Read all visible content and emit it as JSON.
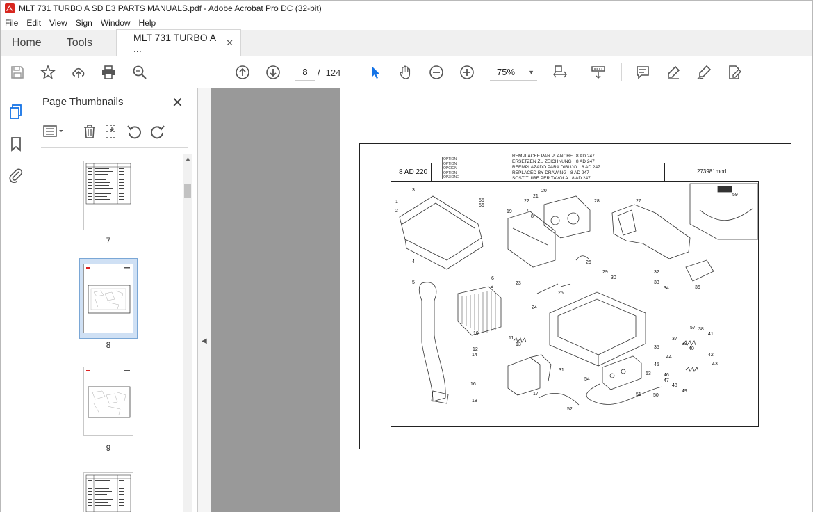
{
  "window": {
    "title": "MLT 731 TURBO A SD E3 PARTS MANUALS.pdf - Adobe Acrobat Pro DC (32-bit)",
    "controls": {
      "minimize": "—",
      "maximize": "☐",
      "close": "✕"
    }
  },
  "menu": [
    "File",
    "Edit",
    "View",
    "Sign",
    "Window",
    "Help"
  ],
  "tabs": {
    "home": "Home",
    "tools": "Tools",
    "document": "MLT 731 TURBO A ...",
    "close": "✕"
  },
  "toolbar": {
    "current_page": "8",
    "page_separator": "/",
    "total_pages": "124",
    "zoom": "75%",
    "zoom_caret": "▼"
  },
  "thumbnails_panel": {
    "title": "Page Thumbnails",
    "close": "✕",
    "pages": [
      {
        "label": "7",
        "selected": false
      },
      {
        "label": "8",
        "selected": true
      },
      {
        "label": "9",
        "selected": false
      },
      {
        "label": "",
        "selected": false
      }
    ]
  },
  "page_content": {
    "part_code": "8 AD 220",
    "options": [
      "OPTION",
      "OPTION",
      "OPCION",
      "OPTION",
      "OPZIONE"
    ],
    "replacement_lines": [
      {
        "text": "REMPLACEE PAR PLANCHE",
        "code": "8 AD 247"
      },
      {
        "text": "ERSETZEN ZU ZEICHNUNG",
        "code": "8 AD 247"
      },
      {
        "text": "REEMPLAZADO PARA DIBUJO",
        "code": "8 AD 247"
      },
      {
        "text": "REPLACED BY DRAWING",
        "code": "8 AD 247"
      },
      {
        "text": "SOSTITUIRE PER TAVOLA",
        "code": "8 AD 247"
      }
    ],
    "reference": "273981mod",
    "callouts": [
      "1",
      "2",
      "3",
      "4",
      "5",
      "6",
      "7",
      "8",
      "9",
      "10",
      "11",
      "12",
      "13",
      "14",
      "16",
      "17",
      "18",
      "19",
      "20",
      "21",
      "22",
      "23",
      "24",
      "25",
      "26",
      "27",
      "28",
      "29",
      "30",
      "31",
      "32",
      "33",
      "34",
      "35",
      "36",
      "37",
      "38",
      "39",
      "40",
      "41",
      "42",
      "43",
      "44",
      "45",
      "46",
      "47",
      "48",
      "49",
      "50",
      "51",
      "52",
      "53",
      "54",
      "55",
      "56",
      "57",
      "59"
    ]
  }
}
